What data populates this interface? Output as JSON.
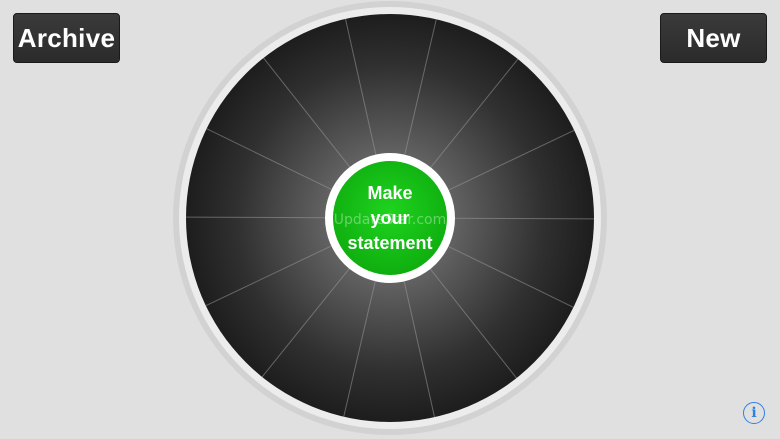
{
  "toolbar": {
    "archive_label": "Archive",
    "new_label": "New"
  },
  "center": {
    "line1": "Make",
    "line2": "your",
    "line3": "statement"
  },
  "watermark": "UpdateStar.com",
  "info": {
    "glyph": "i"
  },
  "wheel": {
    "segment_count": 14
  },
  "colors": {
    "background": "#e0e0e0",
    "button": "#2f2f2f",
    "wheel_dark": "#1e1e1e",
    "wheel_light": "#777777",
    "center_green": "#17bd17",
    "info_blue": "#2f7fe6"
  }
}
